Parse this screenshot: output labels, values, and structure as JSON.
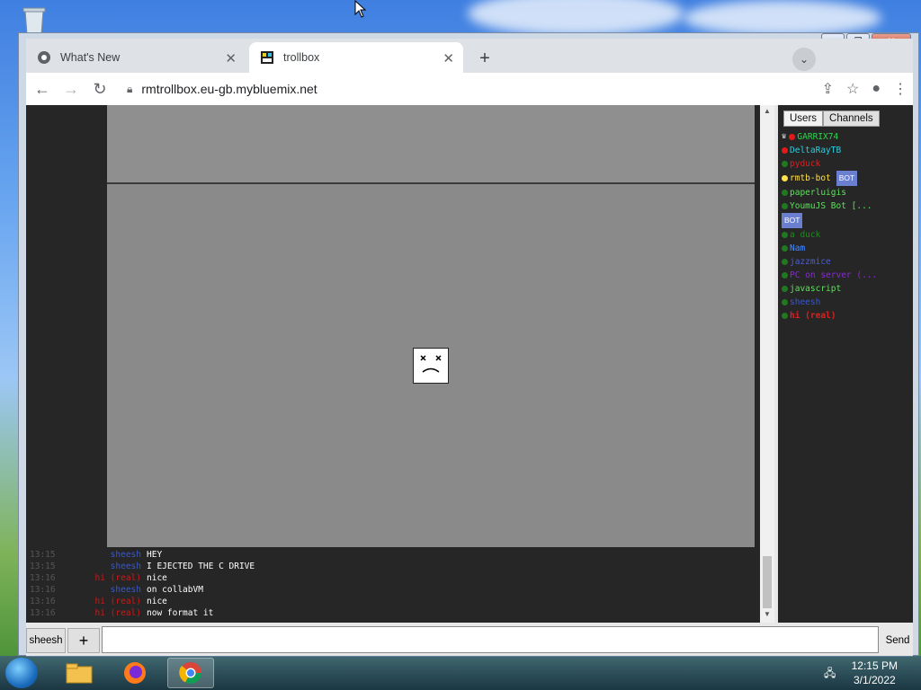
{
  "browser": {
    "tabs": [
      {
        "title": "What's New",
        "active": false
      },
      {
        "title": "trollbox",
        "active": true
      }
    ],
    "url": "rmtrollbox.eu-gb.mybluemix.net"
  },
  "chat": {
    "messages": [
      {
        "time": "13:15",
        "nick": "sheesh",
        "nick_color": "#3a58c8",
        "text": "HEY"
      },
      {
        "time": "13:15",
        "nick": "sheesh",
        "nick_color": "#3a58c8",
        "text": "I EJECTED THE C DRIVE"
      },
      {
        "time": "13:16",
        "nick": "hi (real)",
        "nick_color": "#d01818",
        "text": "nice"
      },
      {
        "time": "13:16",
        "nick": "sheesh",
        "nick_color": "#3a58c8",
        "text": "on collabVM"
      },
      {
        "time": "13:16",
        "nick": "hi (real)",
        "nick_color": "#d01818",
        "text": "nice"
      },
      {
        "time": "13:16",
        "nick": "hi (real)",
        "nick_color": "#d01818",
        "text": "now format it"
      }
    ]
  },
  "panel": {
    "tab_users": "Users",
    "tab_channels": "Channels",
    "users": [
      {
        "name": "GARRIX74",
        "color": "#2ad84a",
        "dot": "#e21a1a",
        "crown": true
      },
      {
        "name": "DeltaRayTB",
        "color": "#27d0e0",
        "dot": "#e21a1a"
      },
      {
        "name": "pyduck",
        "color": "#d82222",
        "dot": "#1f7a1f"
      },
      {
        "name": "rmtb-bot",
        "color": "#ffe14a",
        "dot": "#ffe14a",
        "bot": "BOT"
      },
      {
        "name": "paperluigis",
        "color": "#5ee05e",
        "dot": "#1f7a1f"
      },
      {
        "name": "YoumuJS Bot [...",
        "color": "#5ee05e",
        "dot": "#1f7a1f",
        "bot": "BOT"
      },
      {
        "name": "a duck",
        "color": "#1f8a1f",
        "dot": "#1f7a1f"
      },
      {
        "name": "Nam",
        "color": "#4a8cff",
        "dot": "#1f7a1f"
      },
      {
        "name": "jazzmice",
        "color": "#4a5ce0",
        "dot": "#1f7a1f"
      },
      {
        "name": "PC on server (...",
        "color": "#8a28d8",
        "dot": "#1f7a1f"
      },
      {
        "name": "javascript",
        "color": "#5ee05e",
        "dot": "#1f7a1f"
      },
      {
        "name": "sheesh",
        "color": "#3a58c8",
        "dot": "#1f7a1f"
      },
      {
        "name": "hi (real)",
        "color": "#d82222",
        "dot": "#1f7a1f"
      }
    ]
  },
  "input": {
    "nick_label": "sheesh",
    "plus_label": "+",
    "send_label": "Send",
    "value": ""
  },
  "taskbar": {
    "time": "12:15 PM",
    "date": "3/1/2022"
  }
}
